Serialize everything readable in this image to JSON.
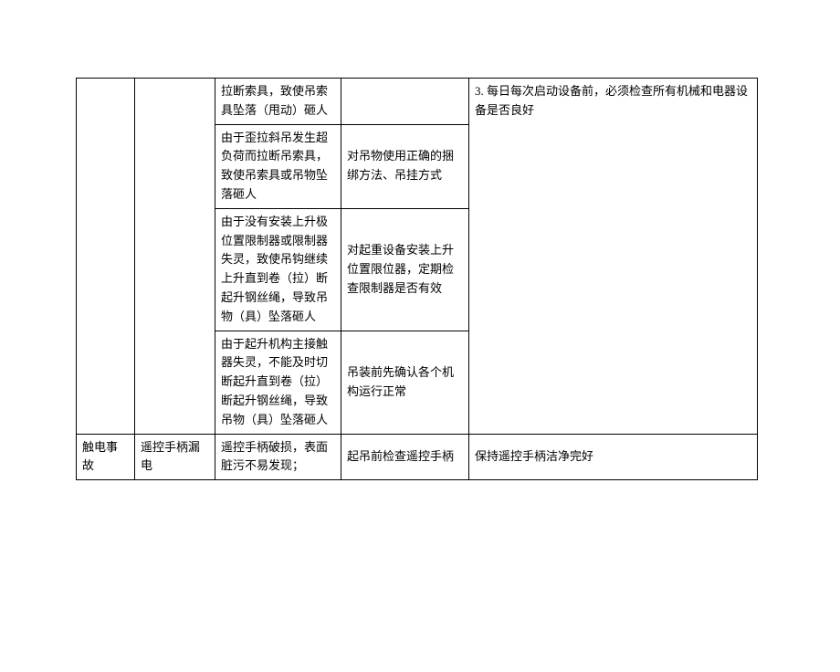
{
  "rows": [
    {
      "c3": "拉断索具，致使吊索具坠落（甩动）砸人",
      "c4": "",
      "c5": "3. 每日每次启动设备前，必须检查所有机械和电器设备是否良好"
    },
    {
      "c3": "由于歪拉斜吊发生超负荷而拉断吊索具，致使吊索具或吊物坠落砸人",
      "c4": "对吊物使用正确的捆绑方法、吊挂方式"
    },
    {
      "c3": "由于没有安装上升极位置限制器或限制器失灵，致使吊钩继续上升直到卷（拉）断起升钢丝绳，导致吊物（具）坠落砸人",
      "c4": "对起重设备安装上升位置限位器，定期检查限制器是否有效"
    },
    {
      "c3": "由于起升机构主接触器失灵，不能及时切断起升直到卷（拉）断起升钢丝绳，导致吊物（具）坠落砸人",
      "c4": "吊装前先确认各个机构运行正常"
    },
    {
      "c1": "触电事故",
      "c2": "遥控手柄漏电",
      "c3": "遥控手柄破损，表面脏污不易发现；",
      "c4": "起吊前检查遥控手柄",
      "c5": "保持遥控手柄洁净完好"
    }
  ]
}
